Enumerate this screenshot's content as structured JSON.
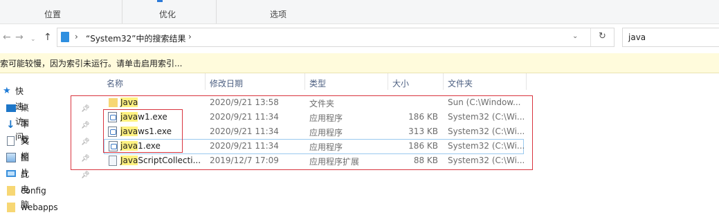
{
  "ribbon": {
    "group1": "位置",
    "group2": "优化",
    "group3": "选项"
  },
  "address": {
    "path": "“System32”中的搜索结果",
    "sep": "›",
    "search_value": "java"
  },
  "infobar": {
    "text": "索可能较慢，因为索引未运行。请单击启用索引..."
  },
  "sidebar": {
    "items": [
      {
        "label": "快速访问",
        "icon": "star-icon"
      },
      {
        "label": "桌面",
        "icon": "desktop-icon"
      },
      {
        "label": "下载",
        "icon": "download-icon"
      },
      {
        "label": "文档",
        "icon": "document-icon"
      },
      {
        "label": "图片",
        "icon": "picture-icon"
      },
      {
        "label": "此电脑",
        "icon": "computer-icon"
      },
      {
        "label": "config",
        "icon": "folder-icon"
      },
      {
        "label": "webapps",
        "icon": "folder-icon"
      }
    ]
  },
  "columns": {
    "name": "名称",
    "date": "修改日期",
    "type": "类型",
    "size": "大小",
    "folder": "文件夹"
  },
  "files": [
    {
      "hl": "Java",
      "rest": "",
      "date": "2020/9/21 13:58",
      "type": "文件夹",
      "size": "",
      "folder": "Sun (C:\\Window...",
      "icon": "folder-icon"
    },
    {
      "hl": "java",
      "rest": "w1.exe",
      "date": "2020/9/21 11:34",
      "type": "应用程序",
      "size": "186 KB",
      "folder": "System32 (C:\\Wi...",
      "icon": "java-exe-icon"
    },
    {
      "hl": "java",
      "rest": "ws1.exe",
      "date": "2020/9/21 11:34",
      "type": "应用程序",
      "size": "313 KB",
      "folder": "System32 (C:\\Wi...",
      "icon": "java-exe-icon"
    },
    {
      "hl": "java",
      "rest": "1.exe",
      "date": "2020/9/21 11:34",
      "type": "应用程序",
      "size": "186 KB",
      "folder": "System32 (C:\\Wi...",
      "icon": "java-exe-icon"
    },
    {
      "hl": "Java",
      "rest": "ScriptCollecti...",
      "date": "2019/12/7 17:09",
      "type": "应用程序扩展",
      "size": "88 KB",
      "folder": "System32 (C:\\Wi...",
      "icon": "dll-icon"
    }
  ],
  "colors": {
    "highlight": "#fff280",
    "annotation_red": "#d9343e",
    "selected_border": "#99c9ef"
  }
}
